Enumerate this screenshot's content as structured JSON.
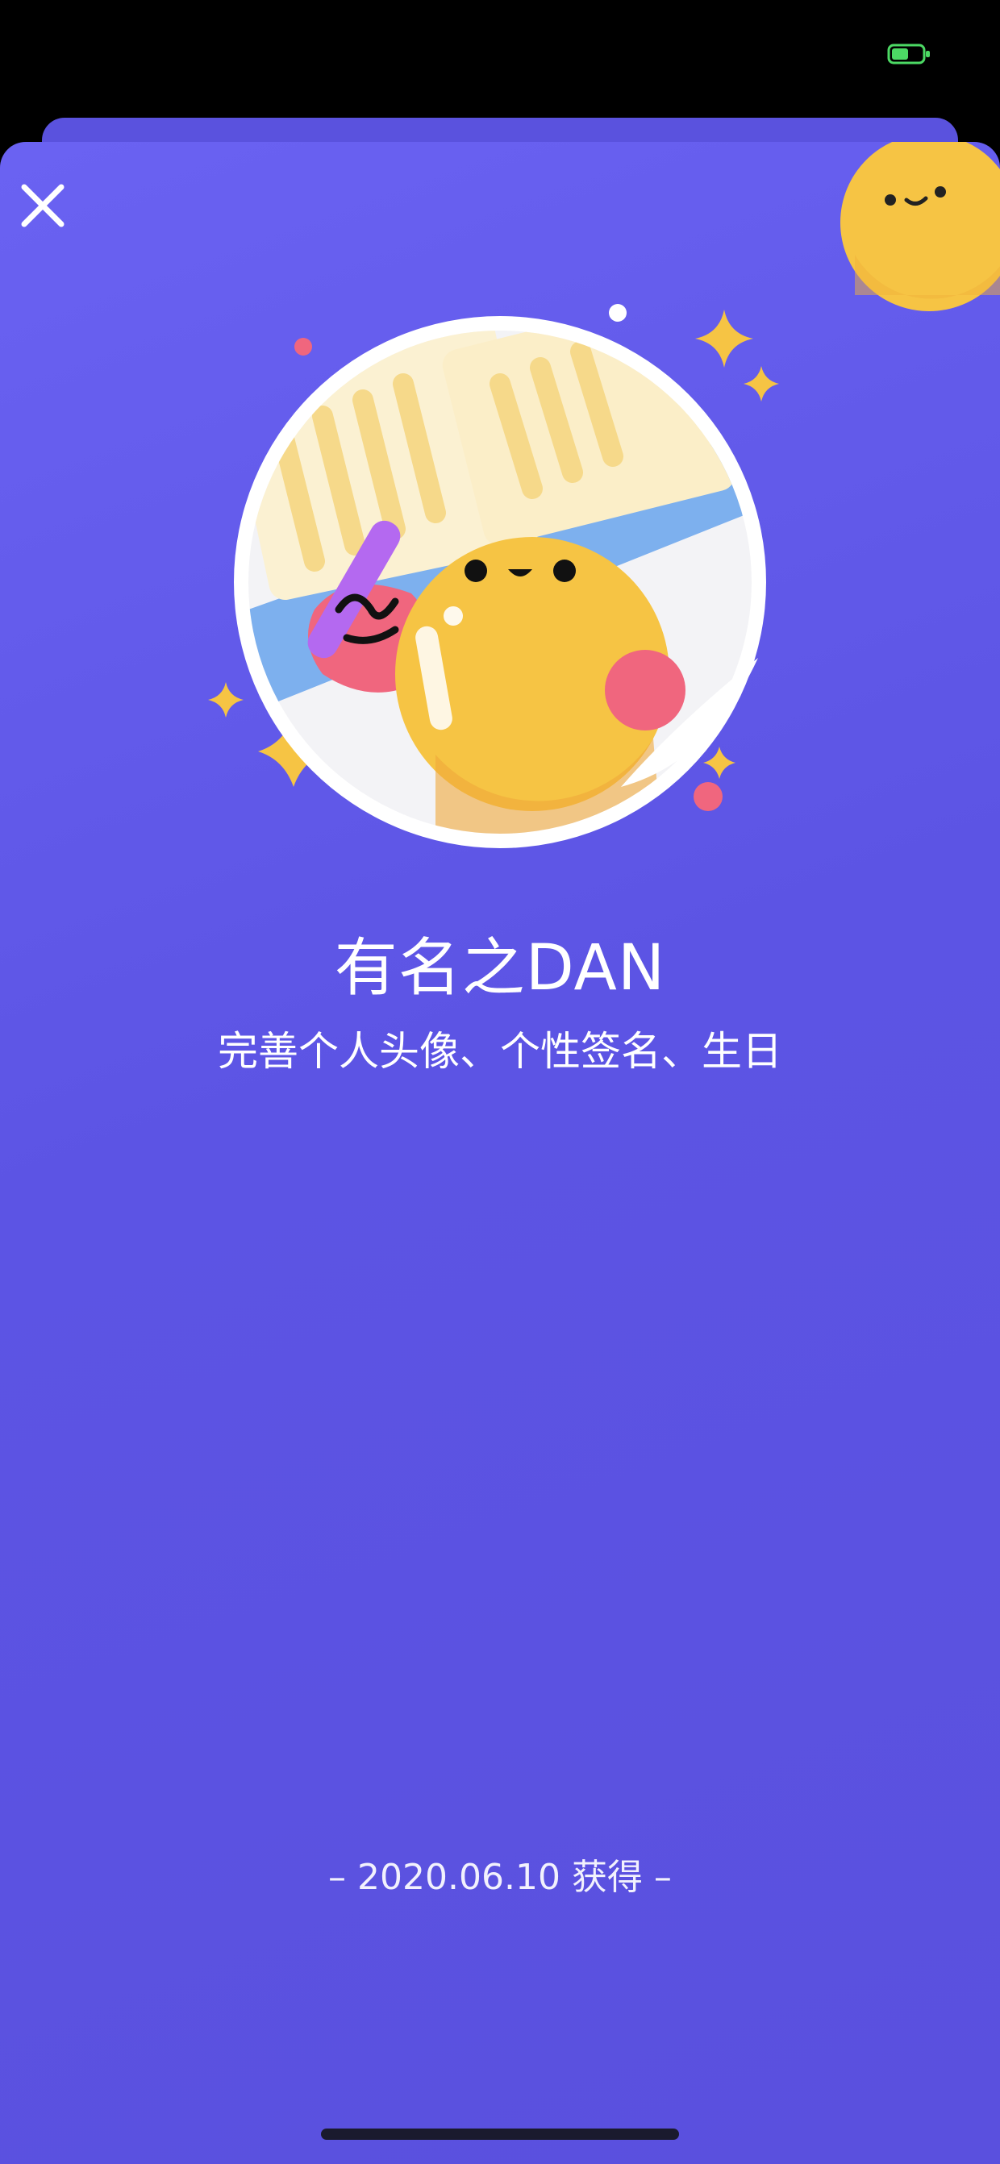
{
  "status_bar": {
    "battery_color": "#4cd964"
  },
  "sheet": {
    "close_icon": "close-icon",
    "badge": {
      "title": "有名之DAN",
      "description": "完善个人头像、个性签名、生日"
    },
    "earned_text": "– 2020.06.10 获得 –"
  },
  "colors": {
    "sheet_bg": "#5f57e8",
    "accent_yellow": "#f6c444",
    "accent_pink": "#f0667e",
    "accent_purple": "#b469f0"
  }
}
